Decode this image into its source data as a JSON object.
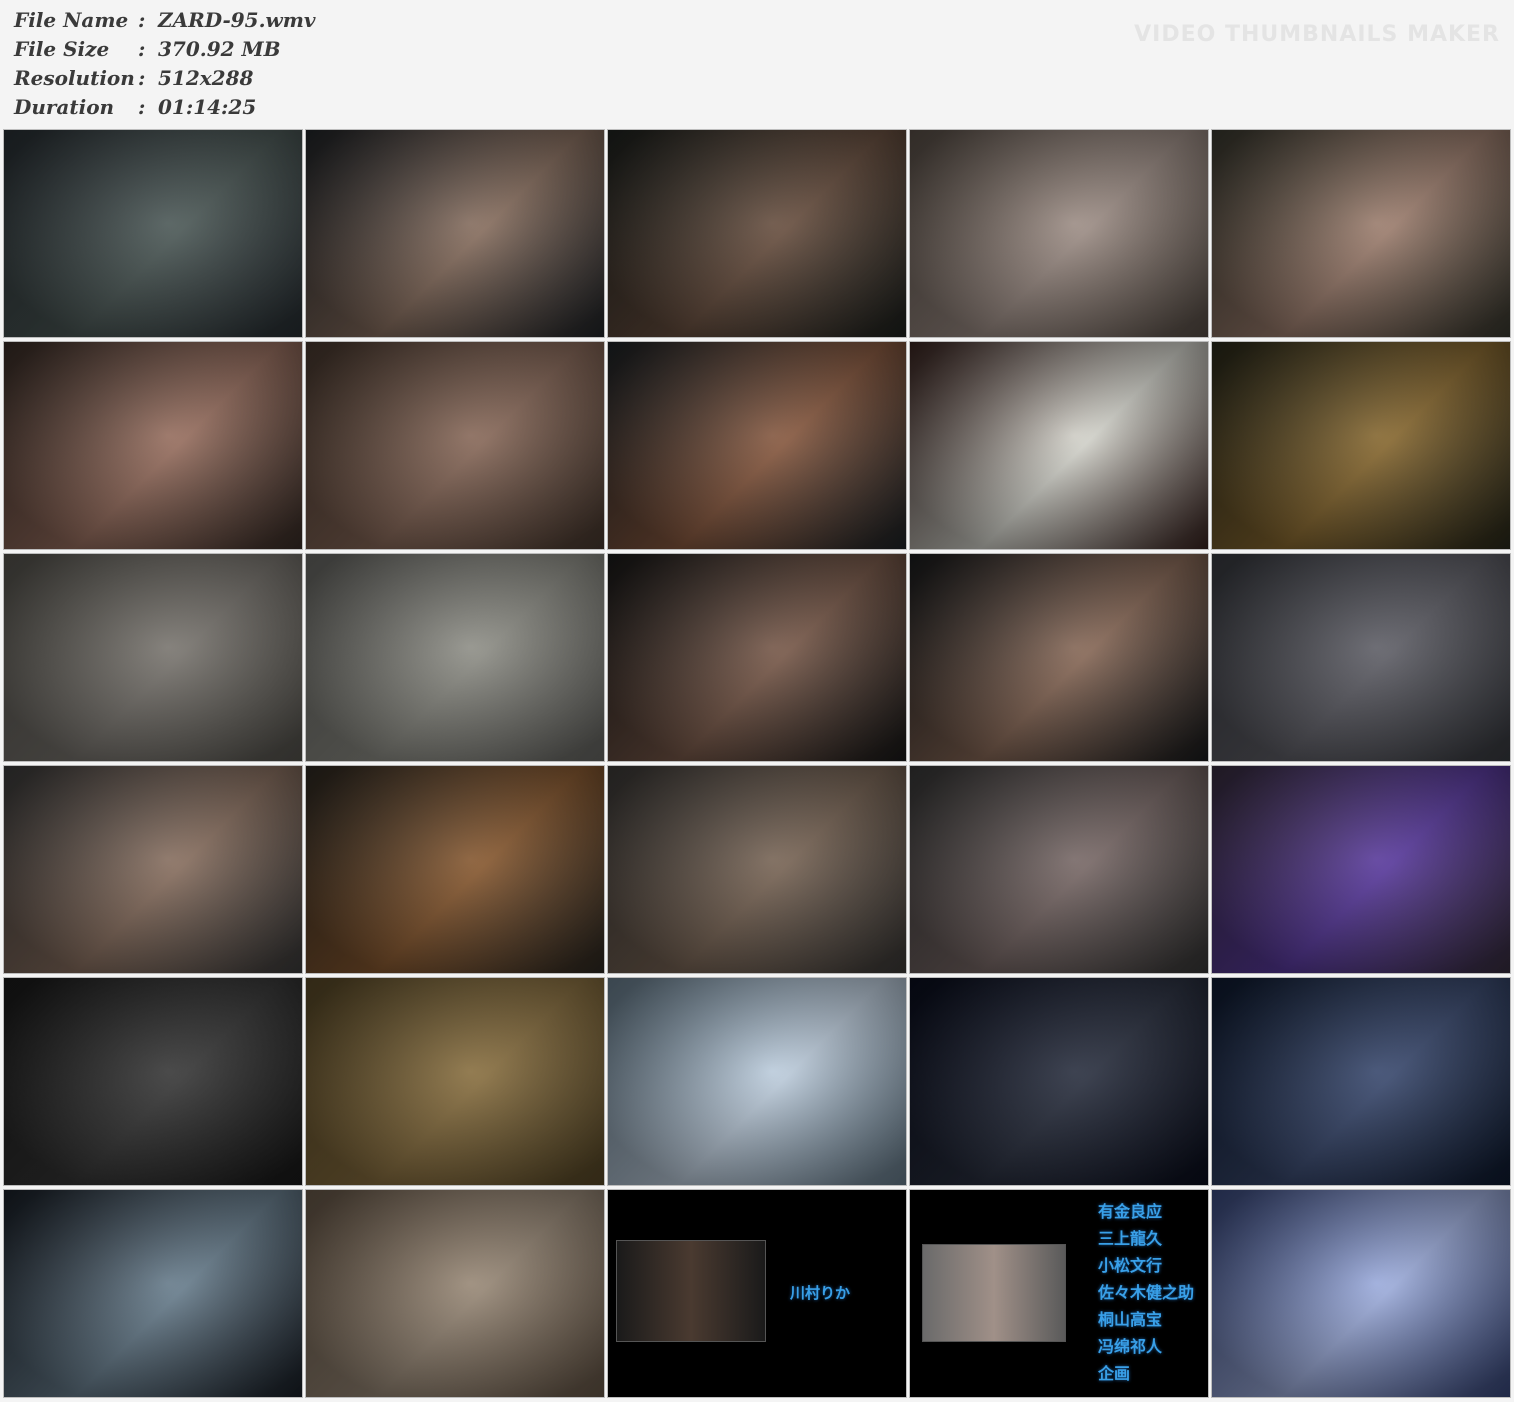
{
  "file_info": {
    "rows": [
      {
        "label": "File Name",
        "value": "ZARD-95.wmv"
      },
      {
        "label": "File Size",
        "value": "370.92 MB"
      },
      {
        "label": "Resolution",
        "value": "512x288"
      },
      {
        "label": "Duration",
        "value": "01:14:25"
      }
    ],
    "separator": ":"
  },
  "watermark": "VIDEO THUMBNAILS MAKER",
  "credits": {
    "thumb_23_name": "川村りか",
    "thumb_24_lines": [
      "有金良应",
      "三上龍久",
      "小松文行",
      "佐々木健之助",
      "桐山高宝",
      "冯绵祁人",
      "企画"
    ]
  },
  "thumbnails": [
    {
      "tone": "#2a3136",
      "tone2": "#4d5a58"
    },
    {
      "tone": "#22262a",
      "tone2": "#8a7060"
    },
    {
      "tone": "#1f2320",
      "tone2": "#6a5040"
    },
    {
      "tone": "#5a5048",
      "tone2": "#a09088"
    },
    {
      "tone": "#3a3a30",
      "tone2": "#a08070"
    },
    {
      "tone": "#3a2e28",
      "tone2": "#9a7060"
    },
    {
      "tone": "#4a3a30",
      "tone2": "#8a6a5a"
    },
    {
      "tone": "#1e2428",
      "tone2": "#8a5a40"
    },
    {
      "tone": "#3a2420",
      "tone2": "#d8d8d0"
    },
    {
      "tone": "#2a2a1c",
      "tone2": "#8a6a30"
    },
    {
      "tone": "#585650",
      "tone2": "#7a7670"
    },
    {
      "tone": "#6a6a66",
      "tone2": "#909088"
    },
    {
      "tone": "#1a1a1a",
      "tone2": "#7a5a4a"
    },
    {
      "tone": "#1a1c1e",
      "tone2": "#8a6a58"
    },
    {
      "tone": "#3a3c42",
      "tone2": "#606068"
    },
    {
      "tone": "#3e3e3e",
      "tone2": "#8a7060"
    },
    {
      "tone": "#2e2a24",
      "tone2": "#8a5a30"
    },
    {
      "tone": "#3e3c3a",
      "tone2": "#7a6656"
    },
    {
      "tone": "#3a3a3a",
      "tone2": "#7a6a68"
    },
    {
      "tone": "#3a3040",
      "tone2": "#5a3aa0"
    },
    {
      "tone": "#1a1a1a",
      "tone2": "#383838"
    },
    {
      "tone": "#5a4a28",
      "tone2": "#8a7040"
    },
    {
      "tone": "#6a8090",
      "tone2": "#c0d0e0"
    },
    {
      "tone": "#0a0e1e",
      "tone2": "#2a3040"
    },
    {
      "tone": "#0e1a30",
      "tone2": "#3a4a70"
    },
    {
      "tone": "#1a2028",
      "tone2": "#6a8090"
    },
    {
      "tone": "#6a5a4a",
      "tone2": "#9a8a78"
    },
    {
      "tone": "#000000",
      "tone2": "#000000"
    },
    {
      "tone": "#000000",
      "tone2": "#000000"
    },
    {
      "tone": "#3a4a80",
      "tone2": "#a0b0e0"
    }
  ]
}
